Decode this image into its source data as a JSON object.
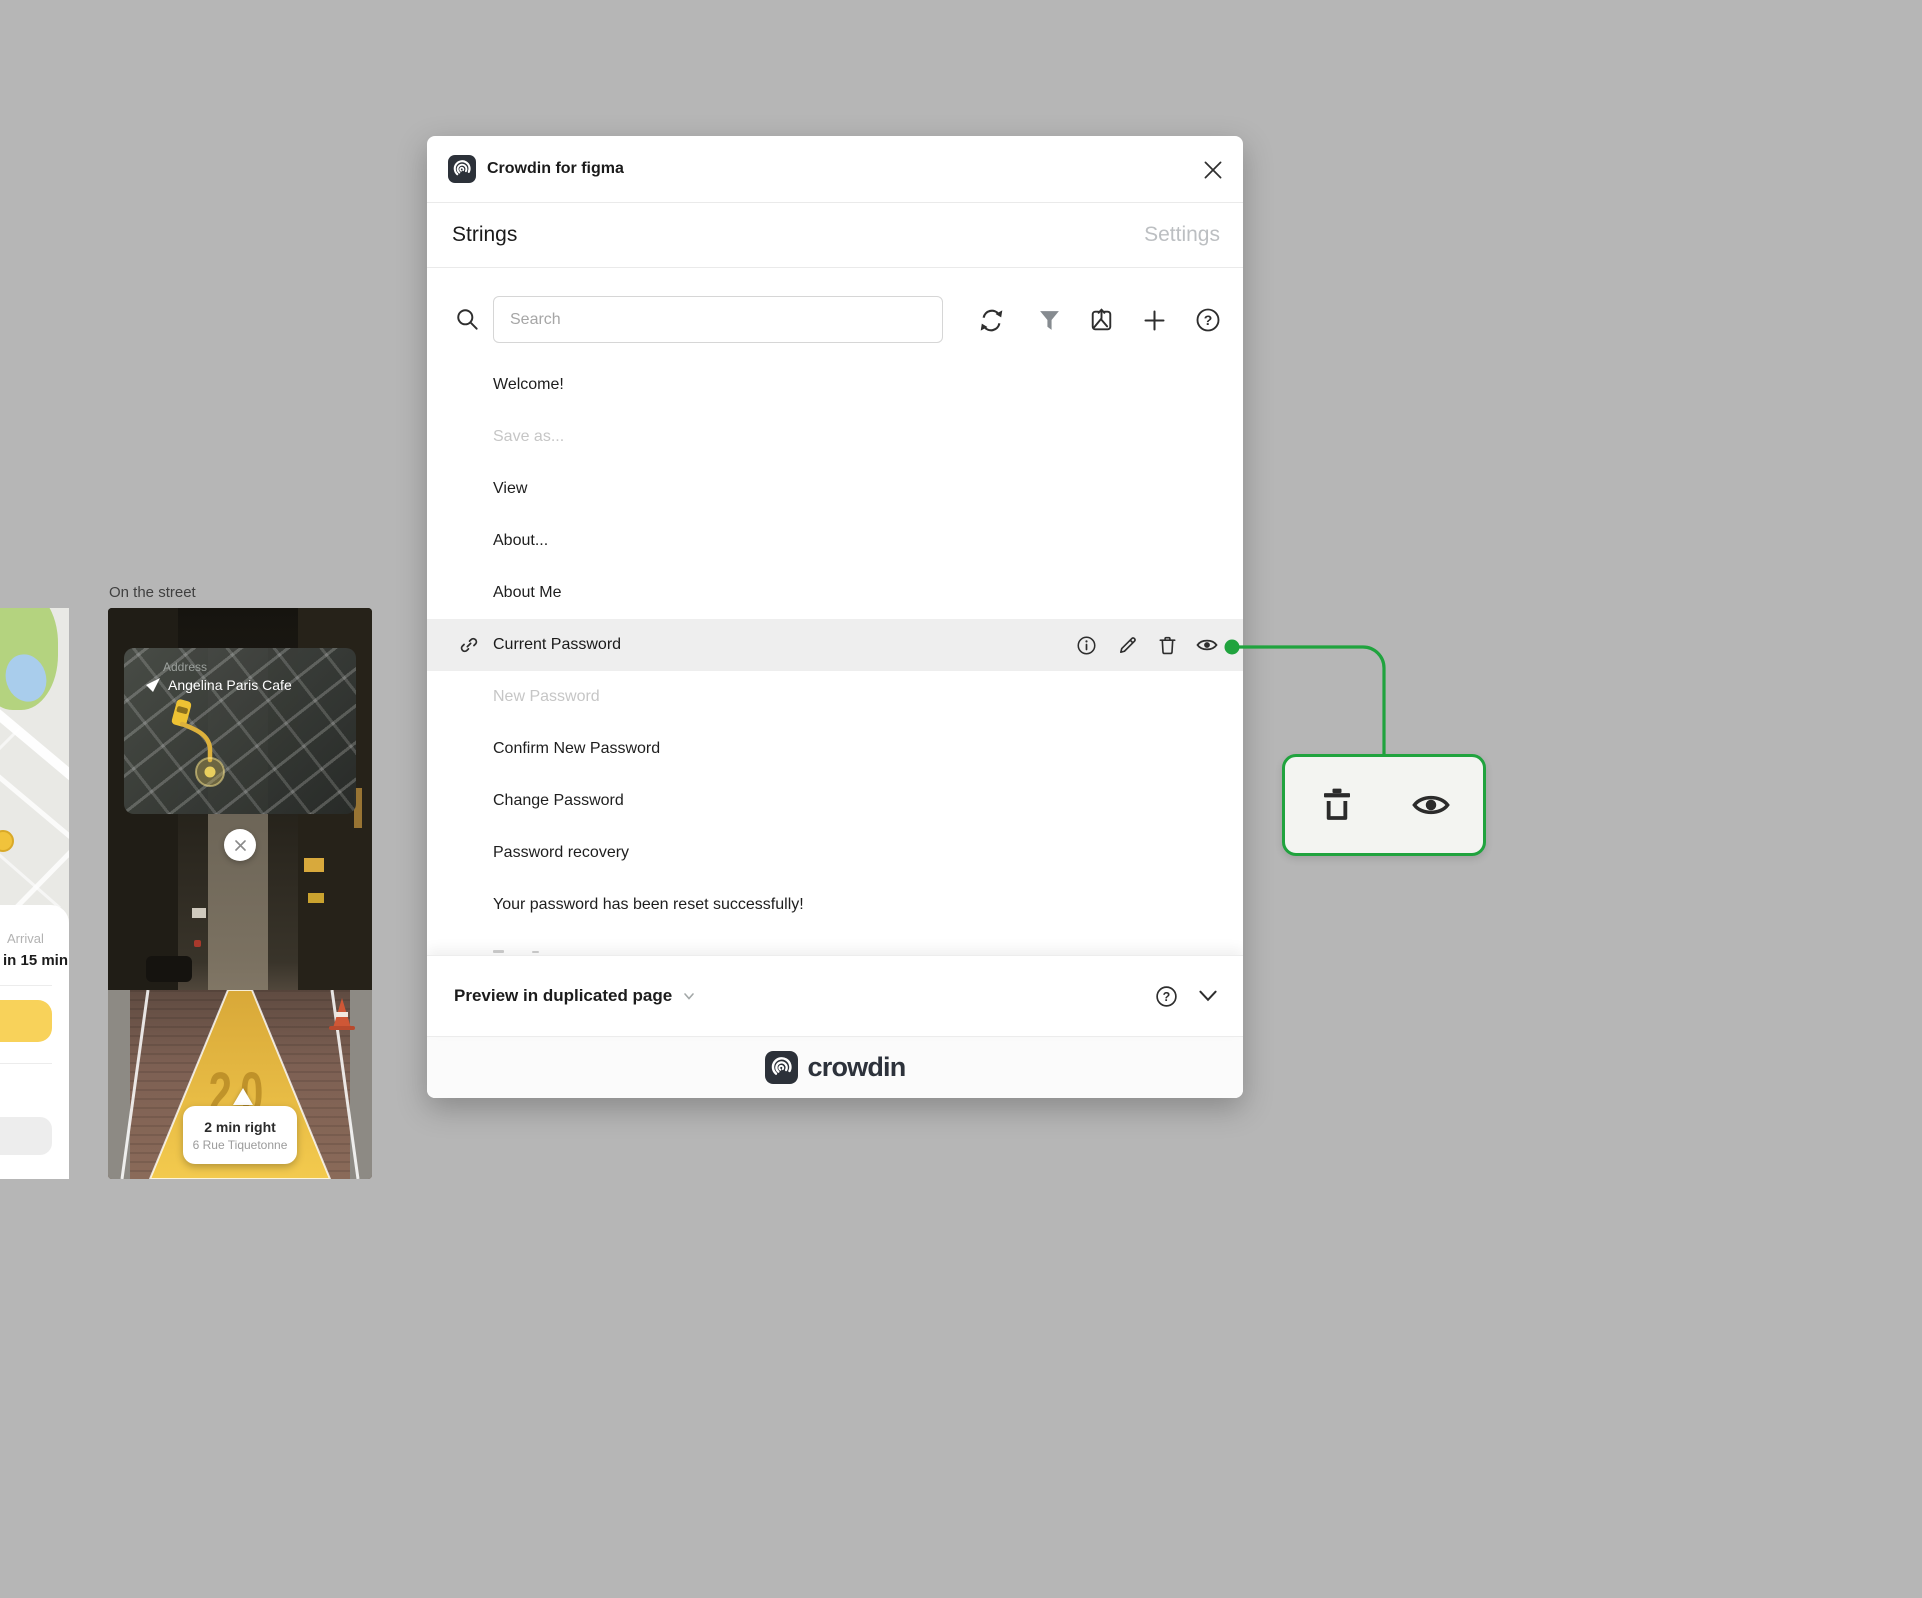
{
  "canvas": {
    "background_color": "#b6b6b6"
  },
  "plugin": {
    "header": {
      "title": "Crowdin for figma"
    },
    "tabs": {
      "strings": "Strings",
      "settings": "Settings"
    },
    "toolbar": {
      "search_placeholder": "Search",
      "help_glyph": "?"
    },
    "list": [
      {
        "label": "Welcome!",
        "state": "normal"
      },
      {
        "label": "Save as...",
        "state": "muted"
      },
      {
        "label": "View",
        "state": "normal"
      },
      {
        "label": "About...",
        "state": "normal"
      },
      {
        "label": "About Me",
        "state": "normal"
      },
      {
        "label": "Current Password",
        "state": "selected"
      },
      {
        "label": "New Password",
        "state": "muted"
      },
      {
        "label": "Confirm New Password",
        "state": "normal"
      },
      {
        "label": "Change Password",
        "state": "normal"
      },
      {
        "label": "Password recovery",
        "state": "normal"
      },
      {
        "label": "Your password has been reset successfully!",
        "state": "normal"
      }
    ],
    "bottom_bar": {
      "label": "Preview in duplicated page",
      "help_glyph": "?"
    },
    "footer": {
      "brand": "crowdin"
    }
  },
  "callout": {
    "border_color": "#20a33e",
    "icons": [
      "trash-icon",
      "eye-icon"
    ]
  },
  "street_artboard": {
    "label": "On the street",
    "address_label": "Address",
    "address_value": "Angelina Paris Cafe",
    "road_number": "20",
    "direction_title": "2 min right",
    "direction_subtitle": "6 Rue Tiquetonne"
  },
  "arrival_artboard": {
    "label": "Arrival",
    "eta": "in 15 min"
  },
  "colors": {
    "accent_green": "#20a33e",
    "selected_row_background": "#eeeeee",
    "taxi_yellow": "#eec233",
    "cta_yellow": "#f8d25a"
  }
}
